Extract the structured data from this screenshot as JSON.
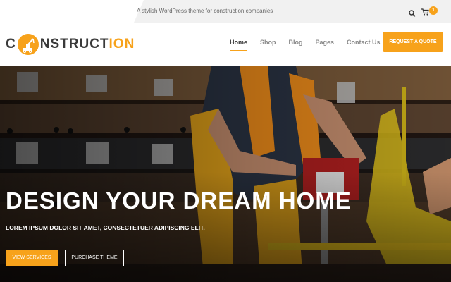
{
  "topbar": {
    "tagline": "A stylish WordPress theme for construction companies",
    "search_icon": "search-icon",
    "cart_icon": "cart-icon",
    "cart_count": "1"
  },
  "header": {
    "logo": {
      "left": "C",
      "right_dark": "NSTRUCT",
      "right_orange": "ION",
      "badge_icon": "crane-icon"
    },
    "nav": [
      {
        "label": "Home",
        "active": true
      },
      {
        "label": "Shop",
        "active": false
      },
      {
        "label": "Blog",
        "active": false
      },
      {
        "label": "Pages",
        "active": false
      },
      {
        "label": "Contact Us",
        "active": false
      }
    ],
    "quote_button": "REQUEST A QUOTE"
  },
  "hero": {
    "title": "DESIGN YOUR DREAM HOME",
    "subtitle": "LOREM IPSUM DOLOR SIT AMET, CONSECTETUER ADIPISCING ELIT.",
    "primary_button": "VIEW SERVICES",
    "secondary_button": "PURCHASE THEME"
  },
  "colors": {
    "accent": "#f7a21b",
    "text_dark": "#333333",
    "topbar_bg": "#f1f1f1"
  }
}
